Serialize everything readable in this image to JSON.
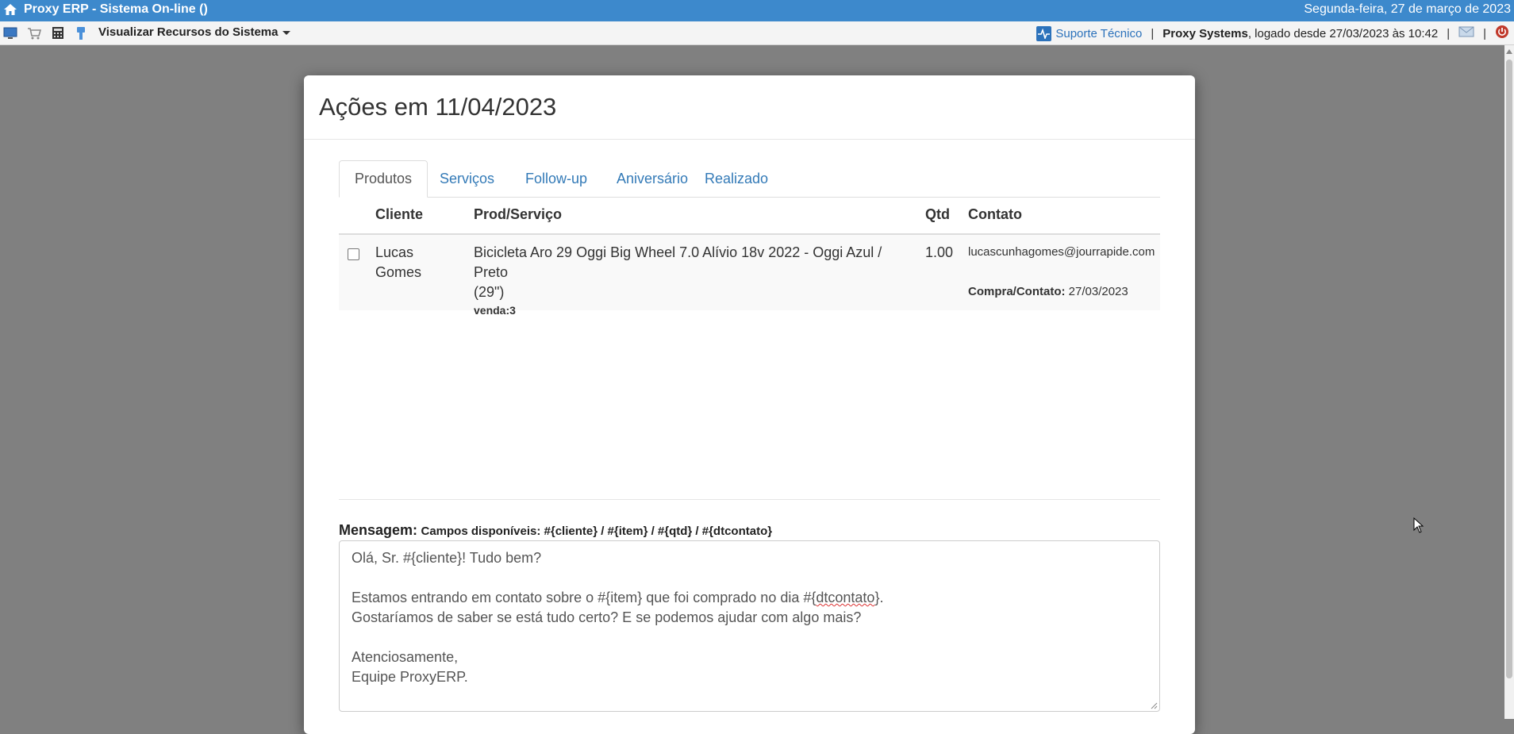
{
  "titlebar": {
    "app_title": "Proxy ERP - Sistema On-line ()",
    "date": "Segunda-feira, 27 de março de 2023"
  },
  "toolbar": {
    "icons": [
      "monitor-icon",
      "cart-icon",
      "calculator-icon",
      "tool-icon"
    ],
    "menu_label": "Visualizar Recursos do Sistema",
    "support_label": "Suporte Técnico",
    "company": "Proxy Systems",
    "logged_text": ", logado desde 27/03/2023 às 10:42",
    "separator": "|"
  },
  "modal": {
    "title": "Ações em 11/04/2023",
    "tabs": [
      {
        "label": "Produtos",
        "active": true
      },
      {
        "label": "Serviços",
        "active": false
      },
      {
        "label": "Follow-up",
        "active": false
      },
      {
        "label": "Aniversário",
        "active": false
      },
      {
        "label": "Realizado",
        "active": false
      }
    ],
    "table": {
      "headers": [
        "Cliente",
        "Prod/Serviço",
        "Qtd",
        "Contato"
      ],
      "rows": [
        {
          "checked": false,
          "cliente_line1": "Lucas",
          "cliente_line2": "Gomes",
          "produto_line1": "Bicicleta Aro 29 Oggi Big Wheel 7.0 Alívio 18v 2022 - Oggi Azul / Preto",
          "produto_line2": "(29\")",
          "venda": "venda:3",
          "qtd": "1.00",
          "email": "lucascunhagomes@jourrapide.com",
          "compra_label": "Compra/Contato:",
          "compra_date": "27/03/2023"
        }
      ]
    },
    "message": {
      "label": "Mensagem:",
      "fields_text": "Campos disponíveis: #{cliente} / #{item} / #{qtd} / #{dtcontato}",
      "line1": "Olá, Sr. #{cliente}! Tudo bem?",
      "line2_a": "Estamos entrando em contato sobre o #{item} que foi comprado no dia #{",
      "line2_b": "dtcontato",
      "line2_c": "}.",
      "line3": "Gostaríamos de saber se está tudo certo? E se podemos ajudar com algo mais?",
      "line4": "Atenciosamente,",
      "line5": "Equipe ProxyERP."
    }
  },
  "colors": {
    "titlebar": "#3d89cc",
    "link": "#337ab7",
    "overlay": "#808080",
    "logout": "#c0392b"
  }
}
